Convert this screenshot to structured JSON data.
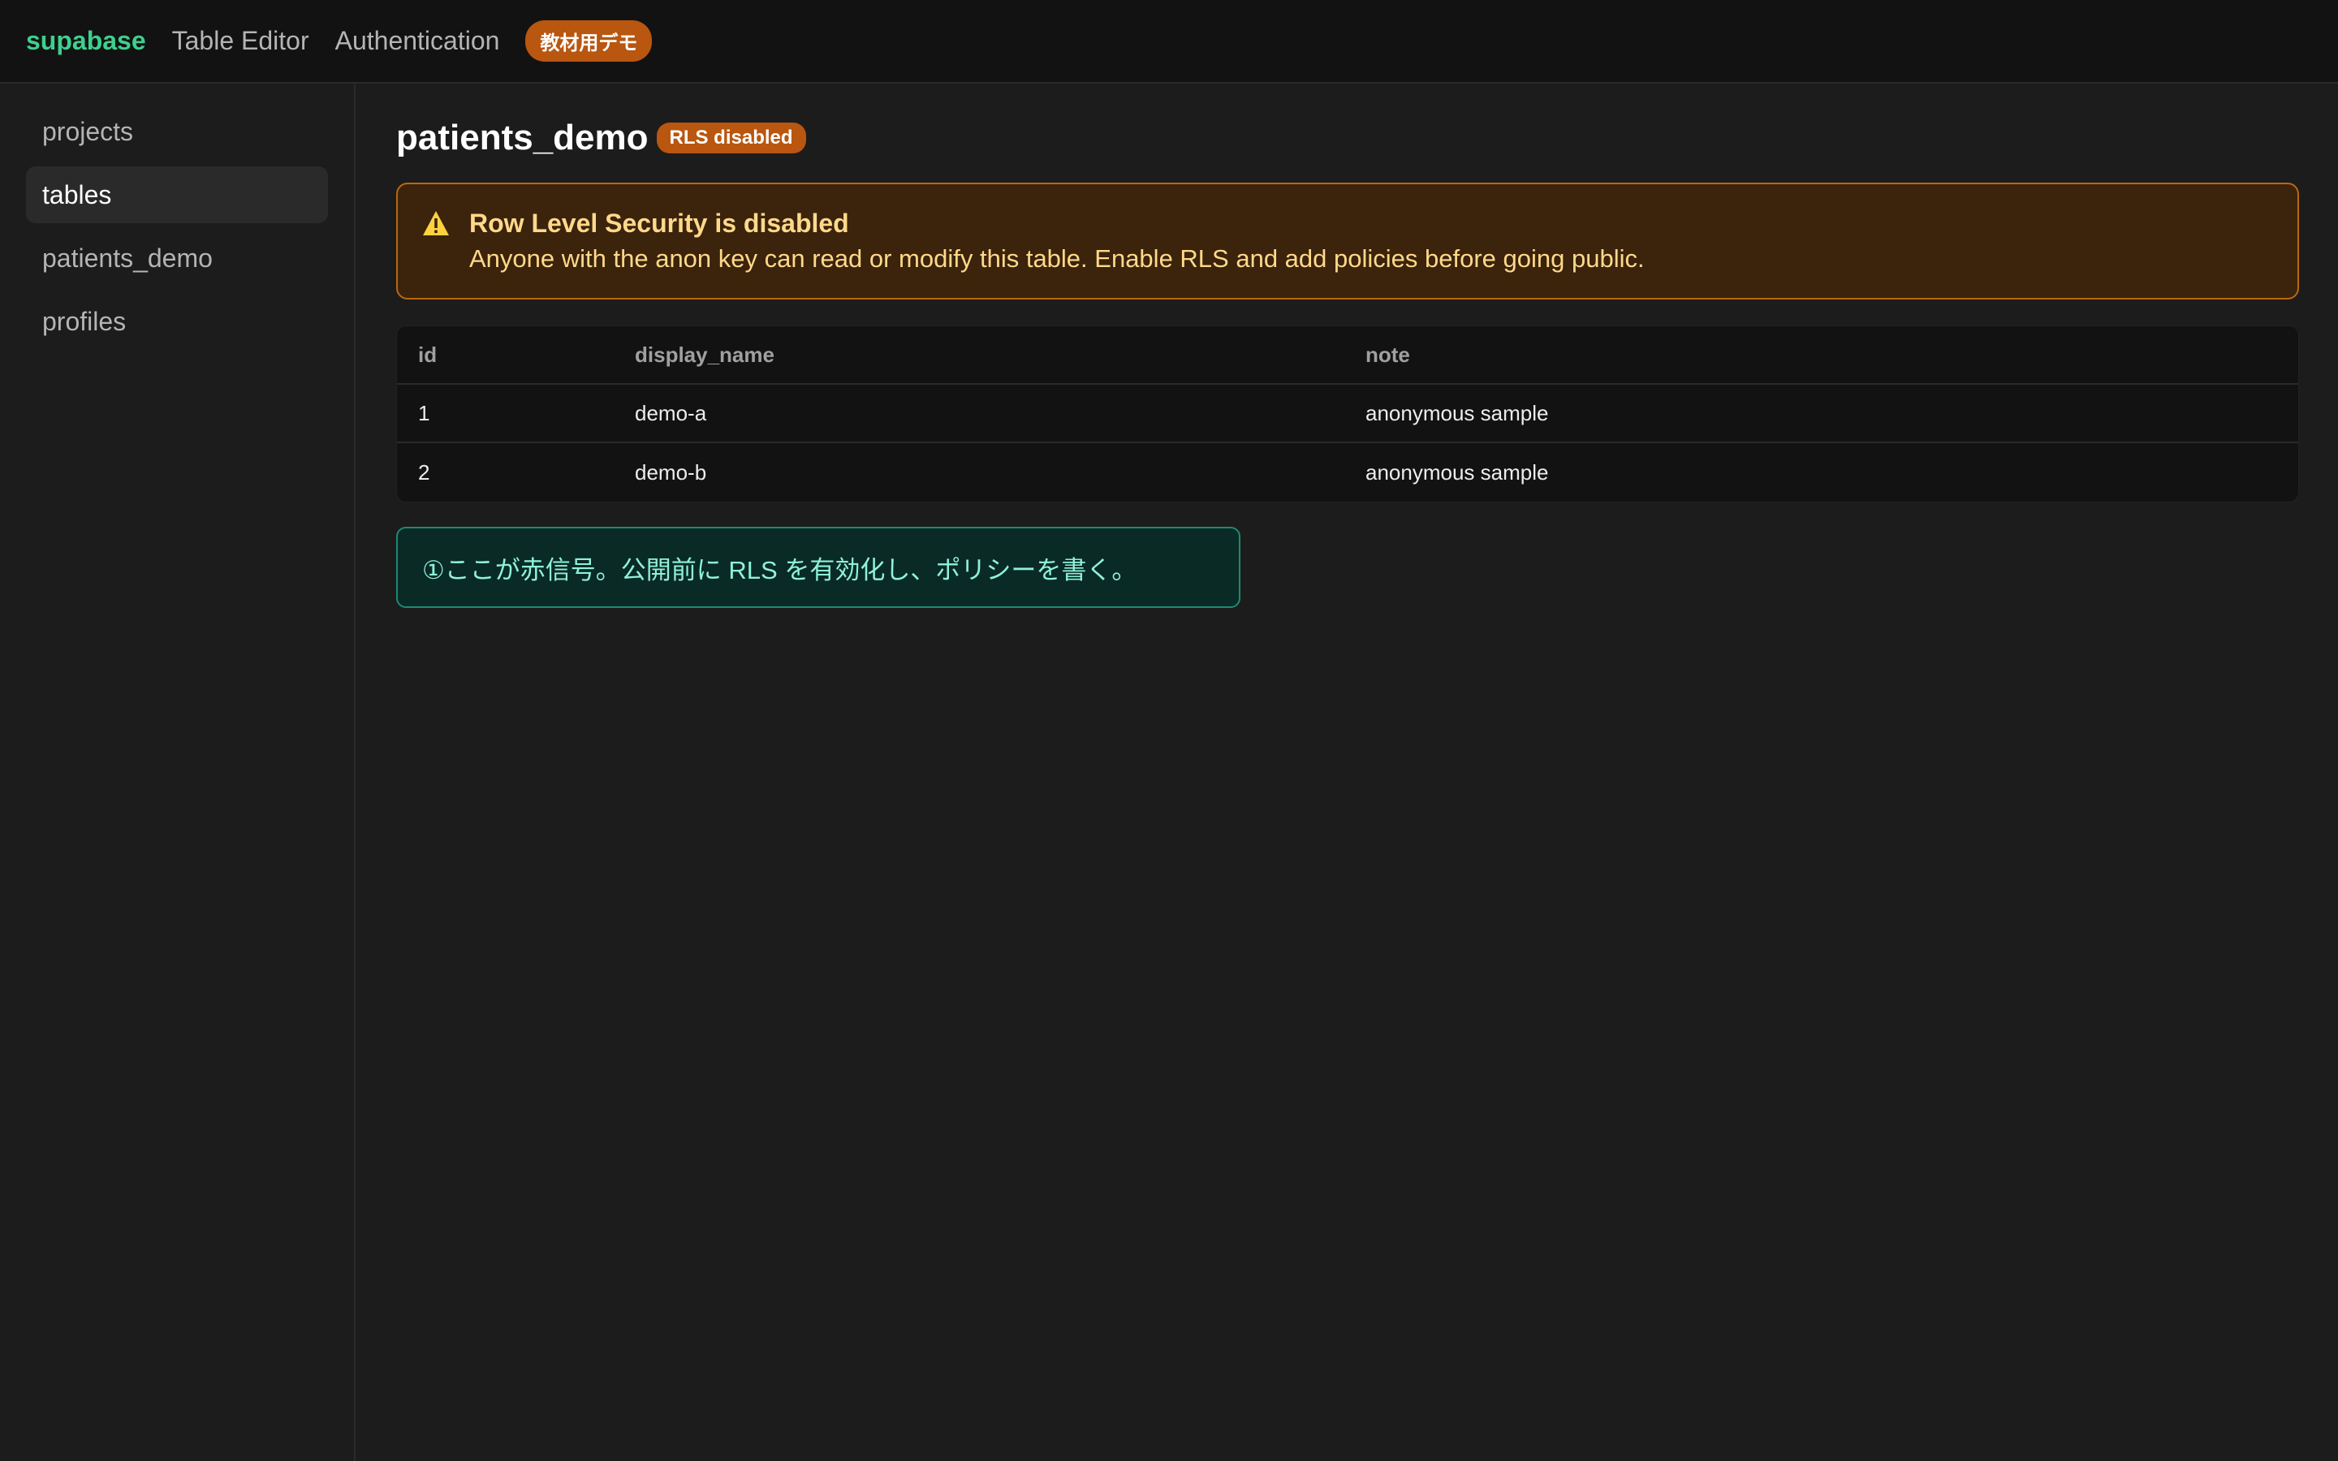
{
  "topbar": {
    "brand": "supabase",
    "nav": [
      "Table Editor",
      "Authentication"
    ],
    "badge": "教材用デモ"
  },
  "sidebar": {
    "items": [
      {
        "label": "projects",
        "active": false
      },
      {
        "label": "tables",
        "active": true
      },
      {
        "label": "patients_demo",
        "active": false
      },
      {
        "label": "profiles",
        "active": false
      }
    ]
  },
  "main": {
    "title": "patients_demo",
    "rls_badge": "RLS disabled",
    "warning": {
      "icon": "warning-triangle-icon",
      "title": "Row Level Security is disabled",
      "body": "Anyone with the anon key can read or modify this table. Enable RLS and add policies before going public."
    },
    "table": {
      "columns": [
        "id",
        "display_name",
        "note"
      ],
      "rows": [
        [
          "1",
          "demo-a",
          "anonymous sample"
        ],
        [
          "2",
          "demo-b",
          "anonymous sample"
        ]
      ]
    },
    "note": "①ここが赤信号。公開前に RLS を有効化し、ポリシーを書く。"
  },
  "colors": {
    "brand": "#3ecf8e",
    "badge": "#b9560f",
    "warning_bg": "#3b230c",
    "warning_text": "#ffd98a",
    "note_bg": "#0a2a26",
    "note_text": "#8ff2d8"
  }
}
